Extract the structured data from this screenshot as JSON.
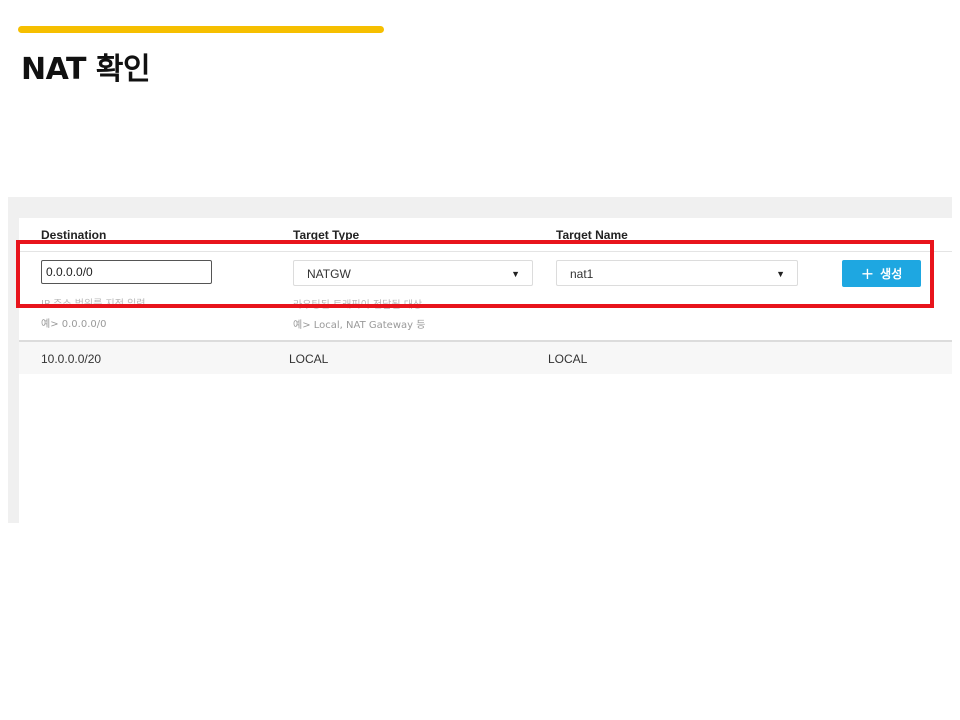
{
  "slide": {
    "title": "NAT 확인",
    "accent_color": "#f6bf00"
  },
  "table": {
    "headers": {
      "destination": "Destination",
      "target_type": "Target Type",
      "target_name": "Target Name"
    },
    "form": {
      "destination_value": "0.0.0.0/0",
      "target_type_selected": "NATGW",
      "target_name_selected": "nat1",
      "create_button_label": "생성",
      "create_button_icon": "plus-icon",
      "create_button_color": "#1ea7e1",
      "destination_hint": "IP 주소 범위를 지정 입력",
      "destination_example": "예> 0.0.0.0/0",
      "target_type_hint": "라우팅된 트래픽이 전달될 대상",
      "target_type_example": "예> Local, NAT Gateway 등"
    },
    "rows": [
      {
        "destination": "10.0.0.0/20",
        "target_type": "LOCAL",
        "target_name": "LOCAL"
      }
    ]
  },
  "annotation": {
    "highlight_color": "#e8141c"
  }
}
